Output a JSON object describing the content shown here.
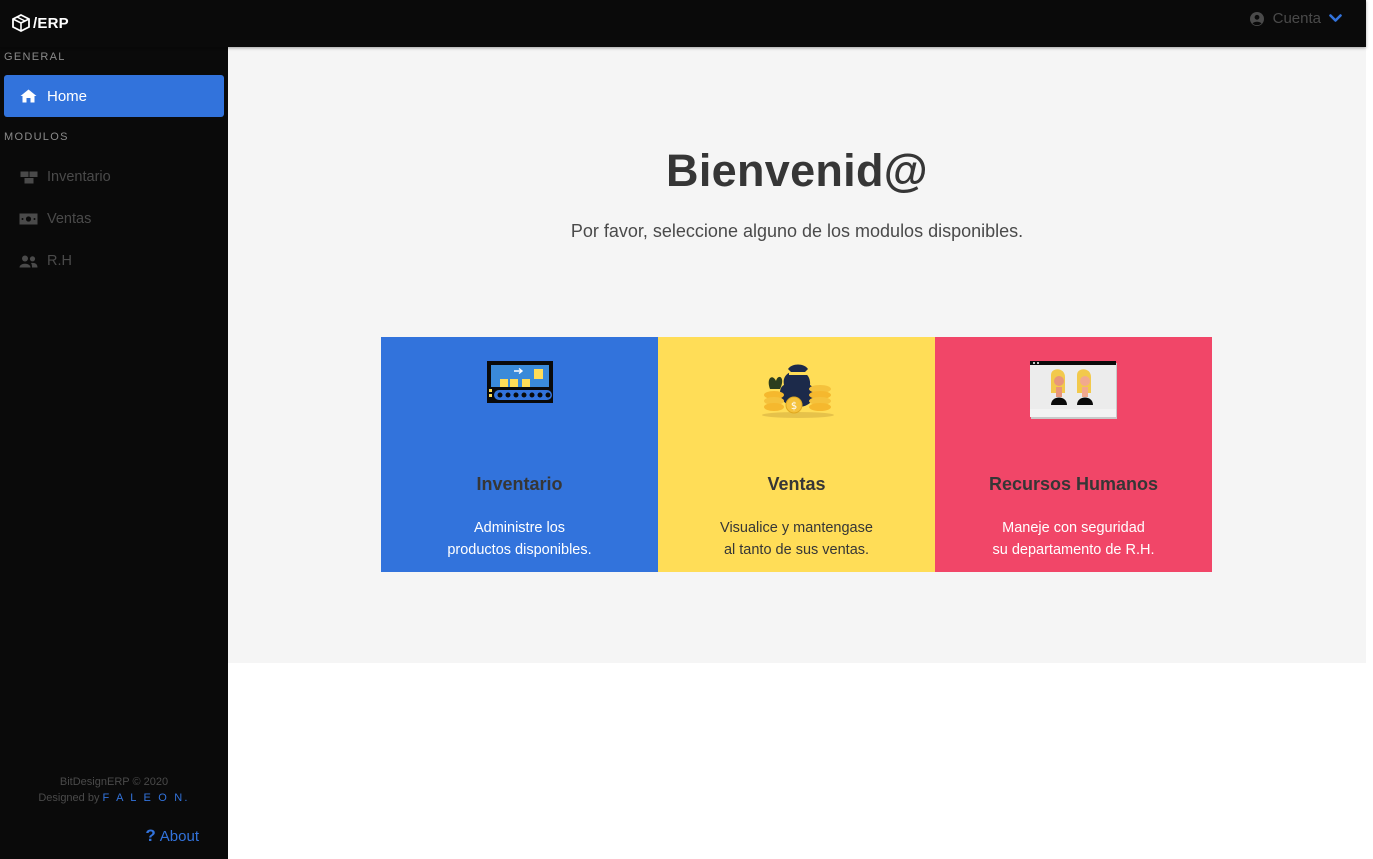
{
  "app": {
    "logo_text": "/ERP"
  },
  "topbar": {
    "account_label": "Cuenta"
  },
  "sidebar": {
    "general_label": "GENERAL",
    "home_label": "Home",
    "modulos_label": "MODULOS",
    "items": [
      {
        "label": "Inventario",
        "icon": "boxes-icon"
      },
      {
        "label": "Ventas",
        "icon": "money-bill-icon"
      },
      {
        "label": "R.H",
        "icon": "users-icon"
      }
    ],
    "footer": {
      "copyright": "BitDesignERP © 2020",
      "designed_by": "Designed by",
      "author": "F A L E O N."
    },
    "about_label": "About"
  },
  "main": {
    "title": "Bienvenid@",
    "subtitle": "Por favor, seleccione alguno de los modulos disponibles."
  },
  "cards": [
    {
      "title": "Inventario",
      "desc_line1": "Administre los",
      "desc_line2": "productos disponibles.",
      "color": "#3273dc"
    },
    {
      "title": "Ventas",
      "desc_line1": "Visualice y mantengase",
      "desc_line2": "al tanto de sus ventas.",
      "color": "#ffdd57"
    },
    {
      "title": "Recursos Humanos",
      "desc_line1": "Maneje con seguridad",
      "desc_line2": "su departamento de R.H.",
      "color": "#f14668"
    }
  ],
  "colors": {
    "primary": "#3273dc",
    "dark": "#0a0a0a",
    "background": "#f5f5f5",
    "warning": "#ffdd57",
    "danger": "#f14668"
  }
}
